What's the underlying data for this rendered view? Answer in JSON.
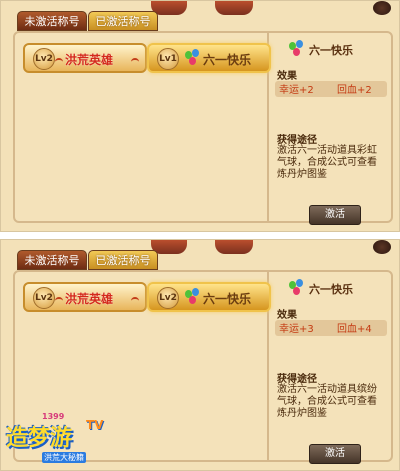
{
  "panels": [
    {
      "tabs": [
        {
          "label": "未激活称号",
          "active": true
        },
        {
          "label": "已激活称号",
          "active": false
        }
      ],
      "titles": [
        {
          "level": "Lv2",
          "name": "洪荒英雄"
        },
        {
          "level": "Lv1",
          "name": "六一快乐"
        }
      ],
      "detail": {
        "title": "六一快乐",
        "effect_label": "效果",
        "effects": [
          "幸运+2",
          "回血+2"
        ],
        "source_label": "获得途径",
        "source_text": "激活六一活动道具彩虹气球，合成公式可查看炼丹炉图鉴",
        "button": "激活"
      }
    },
    {
      "tabs": [
        {
          "label": "未激活称号",
          "active": true
        },
        {
          "label": "已激活称号",
          "active": false
        }
      ],
      "titles": [
        {
          "level": "Lv2",
          "name": "洪荒英雄"
        },
        {
          "level": "Lv2",
          "name": "六一快乐"
        }
      ],
      "detail": {
        "title": "六一快乐",
        "effect_label": "效果",
        "effects": [
          "幸运+3",
          "回血+4"
        ],
        "source_label": "获得途径",
        "source_text": "激活六一活动道具缤纷气球，合成公式可查看炼丹炉图鉴",
        "button": "激活"
      }
    }
  ],
  "logo": {
    "number": "1399",
    "main": "造梦游",
    "tv": "TV",
    "sub": "洪荒大秘籍"
  },
  "colors": {
    "tab_active": "#8e431f",
    "tab_inactive": "#e2ab3b",
    "panel_bg": "#f4e2ba",
    "effect_text": "#c43a12"
  }
}
